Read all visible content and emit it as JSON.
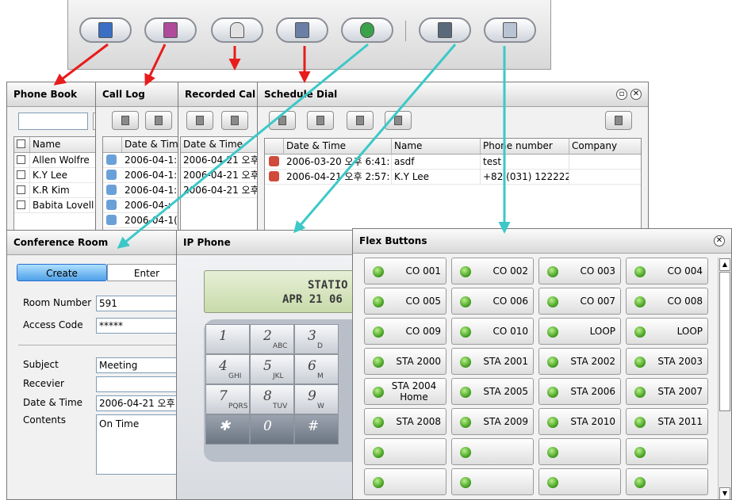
{
  "phone_book": {
    "title": "Phone Book",
    "column_name": "Name",
    "contacts": [
      "Allen Wolfre",
      "K.Y Lee",
      "K.R Kim",
      "Babita Lovell"
    ]
  },
  "call_log": {
    "title": "Call Log",
    "column_date": "Date & Tim",
    "rows": [
      "2006-04-1:",
      "2006-04-1:",
      "2006-04-1:",
      "2006-04-:",
      "2006-04-1("
    ]
  },
  "recorded_calls": {
    "title": "Recorded Cal",
    "column_date": "Date & Time",
    "rows": [
      "2006-04-21 오후",
      "2006-04-21 오후",
      "2006-04-21 오후"
    ]
  },
  "schedule_dial": {
    "title": "Schedule Dial",
    "columns": [
      "Date & Time",
      "Name",
      "Phone number",
      "Company"
    ],
    "rows": [
      {
        "date": "2006-03-20 오후 6:41:",
        "name": "asdf",
        "phone": "test",
        "company": ""
      },
      {
        "date": "2006-04-21 오후 2:57:",
        "name": "K.Y Lee",
        "phone": "+82 (031) 1222222",
        "company": ""
      }
    ]
  },
  "conference_room": {
    "title": "Conference Room",
    "tab_create": "Create",
    "tab_enter": "Enter",
    "room_number_label": "Room Number",
    "room_number_value": "591",
    "access_code_label": "Access Code",
    "access_code_value": "*****",
    "subject_label": "Subject",
    "subject_value": "Meeting",
    "receiver_label": "Recevier",
    "receiver_value": "",
    "datetime_label": "Date & Time",
    "datetime_value": "2006-04-21 오후",
    "contents_label": "Contents",
    "contents_value": "On Time"
  },
  "ip_phone": {
    "title": "IP Phone",
    "display_line1": "STATIO",
    "display_line2": "APR 21 06",
    "keys": [
      {
        "digit": "1",
        "sub": ""
      },
      {
        "digit": "2",
        "sub": "ABC"
      },
      {
        "digit": "3",
        "sub": "D"
      },
      {
        "digit": "4",
        "sub": "GHI"
      },
      {
        "digit": "5",
        "sub": "JKL"
      },
      {
        "digit": "6",
        "sub": "M"
      },
      {
        "digit": "7",
        "sub": "PQRS"
      },
      {
        "digit": "8",
        "sub": "TUV"
      },
      {
        "digit": "9",
        "sub": "W"
      },
      {
        "digit": "✱",
        "sub": ""
      },
      {
        "digit": "0",
        "sub": ""
      },
      {
        "digit": "#",
        "sub": ""
      }
    ]
  },
  "flex_buttons": {
    "title": "Flex Buttons",
    "buttons": [
      "CO 001",
      "CO 002",
      "CO 003",
      "CO 004",
      "CO 005",
      "CO 006",
      "CO 007",
      "CO 008",
      "CO 009",
      "CO 010",
      "LOOP",
      "LOOP",
      "STA 2000",
      "STA 2001",
      "STA 2002",
      "STA 2003",
      "STA 2004 Home",
      "STA 2005",
      "STA 2006",
      "STA 2007",
      "STA 2008",
      "STA 2009",
      "STA 2010",
      "STA 2011",
      "",
      "",
      "",
      "",
      "",
      "",
      "",
      ""
    ]
  },
  "toolbar": {
    "icons": [
      "phone-book-icon",
      "call-log-icon",
      "recorded-calls-icon",
      "schedule-dial-icon",
      "conference-room-icon",
      "ip-phone-icon",
      "flex-buttons-icon"
    ]
  },
  "colors": {
    "arrow_red": "#e81c1c",
    "arrow_teal": "#3cc8c8",
    "led_green": "#3d9a1a",
    "lcd_green": "#d6e6bc"
  }
}
